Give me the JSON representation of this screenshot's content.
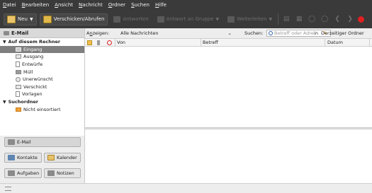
{
  "menubar": {
    "items": [
      {
        "underline": "D",
        "rest": "atei"
      },
      {
        "underline": "B",
        "rest": "earbeiten"
      },
      {
        "underline": "A",
        "rest": "nsicht"
      },
      {
        "underline": "N",
        "rest": "achricht"
      },
      {
        "underline": "O",
        "rest": "rdner"
      },
      {
        "underline": "S",
        "rest": "uchen"
      },
      {
        "underline": "H",
        "rest": "ilfe"
      }
    ]
  },
  "toolbar": {
    "new_label": "Neu",
    "send_receive_label": "Verschicken/Abrufen",
    "reply_label": "Antworten",
    "reply_all_label": "Antwort an Gruppe",
    "forward_label": "Weiterleiten"
  },
  "sidebar": {
    "header": "E-Mail",
    "groups": [
      {
        "label": "Auf diesem Rechner",
        "items": [
          {
            "label": "Eingang",
            "selected": true
          },
          {
            "label": "Ausgang"
          },
          {
            "label": "Entwürfe"
          },
          {
            "label": "Müll"
          },
          {
            "label": "Unerwünscht"
          },
          {
            "label": "Verschickt"
          },
          {
            "label": "Vorlagen"
          }
        ]
      },
      {
        "label": "Suchordner",
        "items": [
          {
            "label": "Nicht einsortiert"
          }
        ]
      }
    ],
    "switcher": {
      "mail": "E-Mail",
      "contacts": "Kontakte",
      "calendar": "Kalender",
      "tasks": "Aufgaben",
      "notes": "Notizen"
    }
  },
  "filterbar": {
    "show_label_ul": "n",
    "show_label_a": "A",
    "show_label_b": "zeigen:",
    "filter_value": "Alle Nachrichten",
    "search_label_a": "S",
    "search_label_u": "u",
    "search_label_b": "chen:",
    "search_placeholder": "Betreff oder Adre",
    "in_label_u": "i",
    "in_label_b": "n",
    "scope_value": "Derzeitiger Ordner"
  },
  "message_list": {
    "columns": {
      "from": "Von",
      "subject": "Betreff",
      "date": "Datum"
    },
    "rows": []
  },
  "colors": {
    "toolbar_bg": "#3a3a3a",
    "selected_folder": "#7f7f7f",
    "stop_red": "#e02020",
    "folder_orange": "#f2a23a"
  }
}
